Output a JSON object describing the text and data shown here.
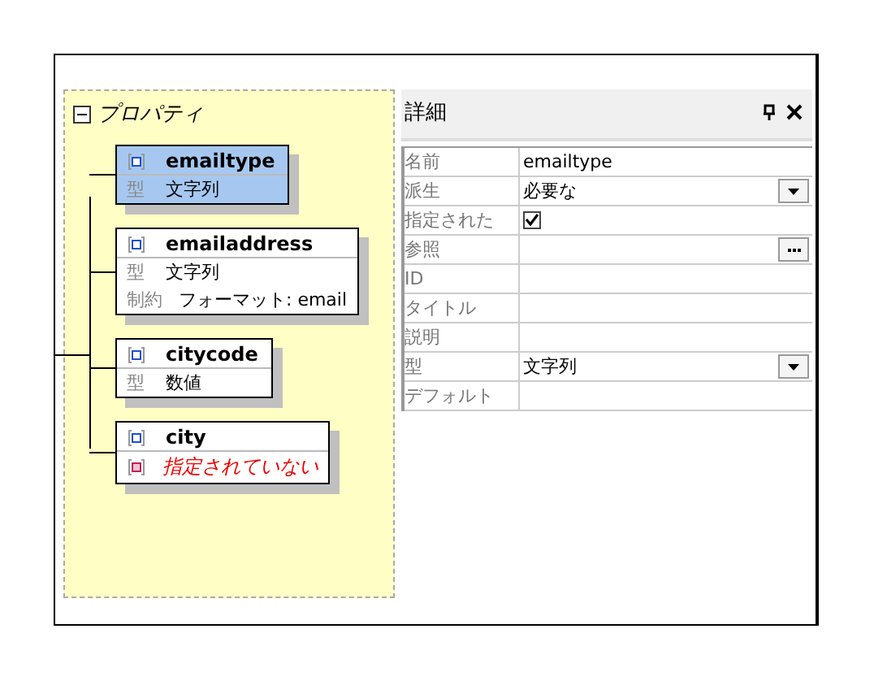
{
  "tree": {
    "title": "プロパティ",
    "expanded": true,
    "nodes": [
      {
        "name": "emailtype",
        "selected": true,
        "rows": [
          {
            "kind": "field",
            "label": "型",
            "value": "文字列"
          }
        ]
      },
      {
        "name": "emailaddress",
        "selected": false,
        "rows": [
          {
            "kind": "field",
            "label": "型",
            "value": "文字列"
          },
          {
            "kind": "field",
            "label": "制約",
            "value": "フォーマット: email"
          }
        ]
      },
      {
        "name": "citycode",
        "selected": false,
        "rows": [
          {
            "kind": "field",
            "label": "型",
            "value": "数値"
          }
        ]
      },
      {
        "name": "city",
        "selected": false,
        "rows": [
          {
            "kind": "unspecified",
            "value": "指定されていない"
          }
        ]
      }
    ]
  },
  "details": {
    "title": "詳細",
    "rows": [
      {
        "kind": "text",
        "label": "名前",
        "value": "emailtype"
      },
      {
        "kind": "dropdown",
        "label": "派生",
        "value": "必要な"
      },
      {
        "kind": "checkbox",
        "label": "指定された",
        "checked": true
      },
      {
        "kind": "ellipsis",
        "label": "参照"
      },
      {
        "kind": "text",
        "label": "ID"
      },
      {
        "kind": "text",
        "label": "タイトル"
      },
      {
        "kind": "text",
        "label": "説明"
      },
      {
        "kind": "dropdown",
        "label": "型",
        "value": "文字列"
      },
      {
        "kind": "text",
        "label": "デフォルト"
      }
    ]
  }
}
